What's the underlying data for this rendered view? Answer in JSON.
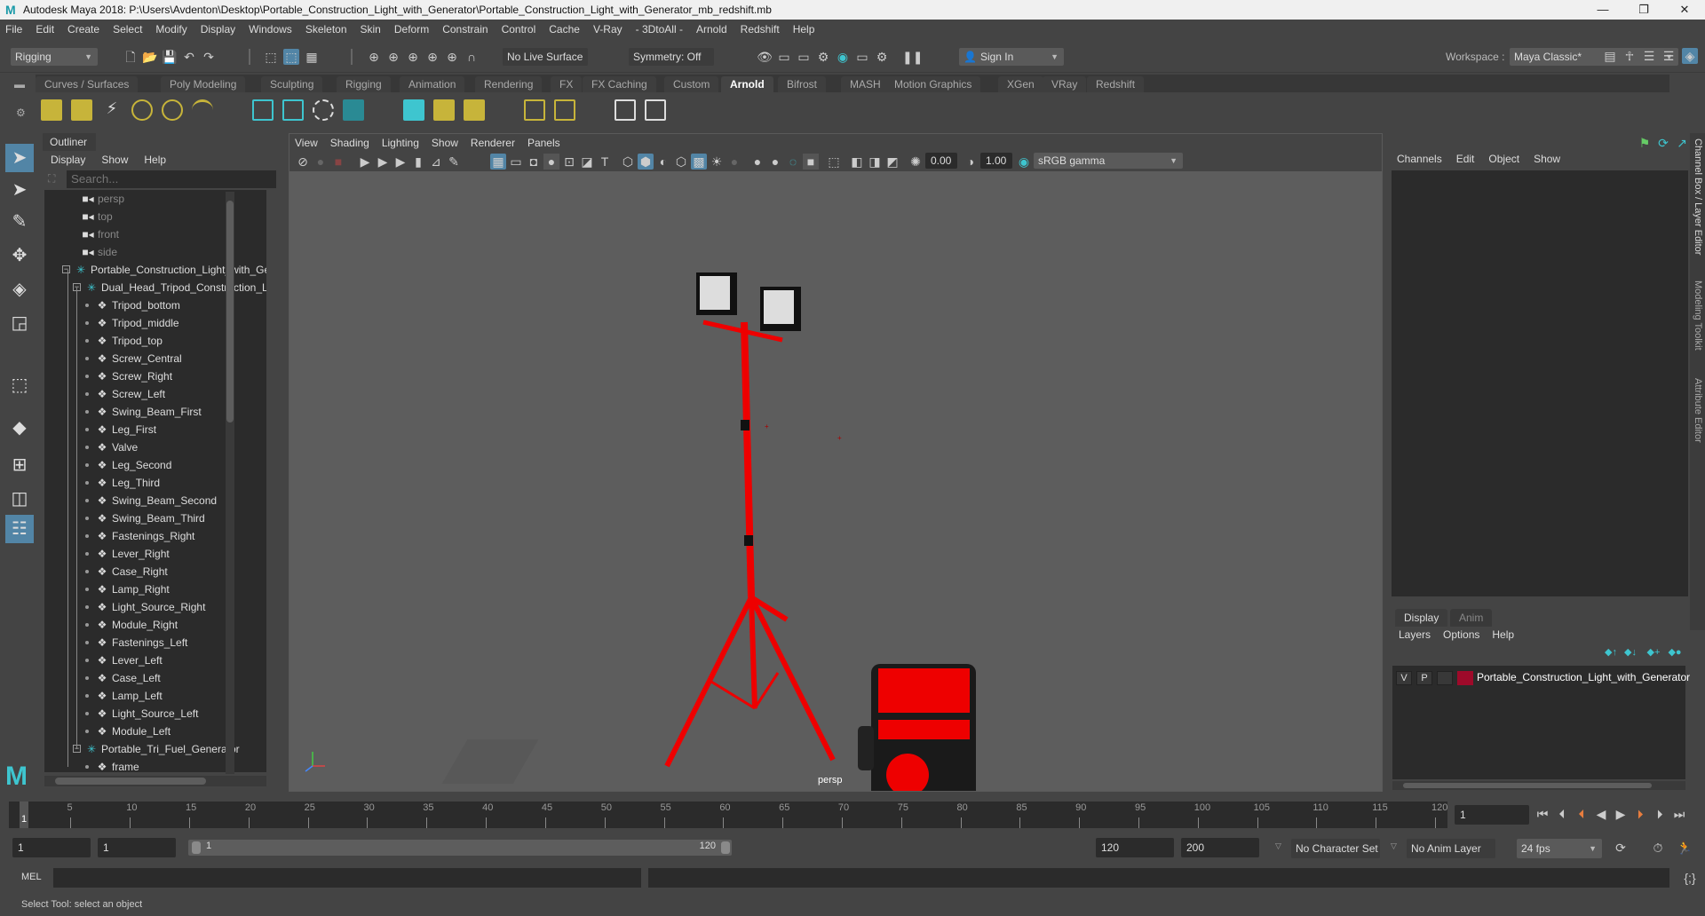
{
  "window": {
    "title": "Autodesk Maya 2018: P:\\Users\\Avdenton\\Desktop\\Portable_Construction_Light_with_Generator\\Portable_Construction_Light_with_Generator_mb_redshift.mb",
    "minimize": "—",
    "maximize": "❐",
    "close": "✕"
  },
  "menubar": [
    "File",
    "Edit",
    "Create",
    "Select",
    "Modify",
    "Display",
    "Windows",
    "Skeleton",
    "Skin",
    "Deform",
    "Constrain",
    "Control",
    "Cache",
    "V-Ray",
    "- 3DtoAll -",
    "Arnold",
    "Redshift",
    "Help"
  ],
  "statusline": {
    "mode": "Rigging",
    "live_surface": "No Live Surface",
    "symmetry": "Symmetry: Off",
    "sign_in": "Sign In",
    "workspace_label": "Workspace :",
    "workspace": "Maya Classic*"
  },
  "shelf": {
    "tabs": [
      "Curves / Surfaces",
      "Poly Modeling",
      "Sculpting",
      "Rigging",
      "Animation",
      "Rendering",
      "FX",
      "FX Caching",
      "Custom",
      "Arnold",
      "Bifrost",
      "MASH",
      "Motion Graphics",
      "XGen",
      "VRay",
      "Redshift"
    ],
    "active_tab": "Arnold"
  },
  "outliner": {
    "title": "Outliner",
    "menu": [
      "Display",
      "Show",
      "Help"
    ],
    "search_placeholder": "Search...",
    "items": [
      {
        "label": "persp",
        "type": "camera",
        "depth": 0
      },
      {
        "label": "top",
        "type": "camera",
        "depth": 0
      },
      {
        "label": "front",
        "type": "camera",
        "depth": 0
      },
      {
        "label": "side",
        "type": "camera",
        "depth": 0
      },
      {
        "label": "Portable_Construction_Light_with_Generator",
        "type": "group",
        "depth": 0
      },
      {
        "label": "Dual_Head_Tripod_Construction_Light",
        "type": "group",
        "depth": 1
      },
      {
        "label": "Tripod_bottom",
        "type": "mesh",
        "depth": 2
      },
      {
        "label": "Tripod_middle",
        "type": "mesh",
        "depth": 2
      },
      {
        "label": "Tripod_top",
        "type": "mesh",
        "depth": 2
      },
      {
        "label": "Screw_Central",
        "type": "mesh",
        "depth": 2
      },
      {
        "label": "Screw_Right",
        "type": "mesh",
        "depth": 2
      },
      {
        "label": "Screw_Left",
        "type": "mesh",
        "depth": 2
      },
      {
        "label": "Swing_Beam_First",
        "type": "mesh",
        "depth": 2
      },
      {
        "label": "Leg_First",
        "type": "mesh",
        "depth": 2
      },
      {
        "label": "Valve",
        "type": "mesh",
        "depth": 2
      },
      {
        "label": "Leg_Second",
        "type": "mesh",
        "depth": 2
      },
      {
        "label": "Leg_Third",
        "type": "mesh",
        "depth": 2
      },
      {
        "label": "Swing_Beam_Second",
        "type": "mesh",
        "depth": 2
      },
      {
        "label": "Swing_Beam_Third",
        "type": "mesh",
        "depth": 2
      },
      {
        "label": "Fastenings_Right",
        "type": "mesh",
        "depth": 2
      },
      {
        "label": "Lever_Right",
        "type": "mesh",
        "depth": 2
      },
      {
        "label": "Case_Right",
        "type": "mesh",
        "depth": 2
      },
      {
        "label": "Lamp_Right",
        "type": "mesh",
        "depth": 2
      },
      {
        "label": "Light_Source_Right",
        "type": "mesh",
        "depth": 2
      },
      {
        "label": "Module_Right",
        "type": "mesh",
        "depth": 2
      },
      {
        "label": "Fastenings_Left",
        "type": "mesh",
        "depth": 2
      },
      {
        "label": "Lever_Left",
        "type": "mesh",
        "depth": 2
      },
      {
        "label": "Case_Left",
        "type": "mesh",
        "depth": 2
      },
      {
        "label": "Lamp_Left",
        "type": "mesh",
        "depth": 2
      },
      {
        "label": "Light_Source_Left",
        "type": "mesh",
        "depth": 2
      },
      {
        "label": "Module_Left",
        "type": "mesh",
        "depth": 2
      },
      {
        "label": "Portable_Tri_Fuel_Generator",
        "type": "group",
        "depth": 1
      },
      {
        "label": "frame",
        "type": "mesh",
        "depth": 2
      }
    ]
  },
  "viewport": {
    "menu": [
      "View",
      "Shading",
      "Lighting",
      "Show",
      "Renderer",
      "Panels"
    ],
    "exposure": "0.00",
    "gamma": "1.00",
    "color_space": "sRGB gamma",
    "camera_label": "persp"
  },
  "channelbox": {
    "menu": [
      "Channels",
      "Edit",
      "Object",
      "Show"
    ]
  },
  "layereditor": {
    "tabs": [
      "Display",
      "Anim"
    ],
    "active_tab": "Display",
    "menu": [
      "Layers",
      "Options",
      "Help"
    ],
    "layers": [
      {
        "v": "V",
        "p": "P",
        "color": "#9e0a2a",
        "name": "Portable_Construction_Light_with_Generator"
      }
    ]
  },
  "side_tabs": [
    "Channel Box / Layer Editor",
    "Modeling Toolkit",
    "Attribute Editor"
  ],
  "timeline": {
    "ticks": [
      5,
      10,
      15,
      20,
      25,
      30,
      35,
      40,
      45,
      50,
      55,
      60,
      65,
      70,
      75,
      80,
      85,
      90,
      95,
      100,
      105,
      110,
      115,
      120
    ],
    "current_frame_marker": "1",
    "current_frame": "1",
    "start": 1,
    "end": 120
  },
  "range": {
    "start_time": "1",
    "playback_start": "1",
    "slider_start": "1",
    "slider_end": "120",
    "playback_end": "120",
    "end_time": "200",
    "character_set": "No Character Set",
    "anim_layer": "No Anim Layer",
    "fps": "24 fps"
  },
  "command": {
    "lang": "MEL"
  },
  "help_line": "Select Tool: select an object",
  "colors": {
    "accent": "#5285a6",
    "teal": "#3ec5cf",
    "layer_red": "#9e0a2a"
  }
}
